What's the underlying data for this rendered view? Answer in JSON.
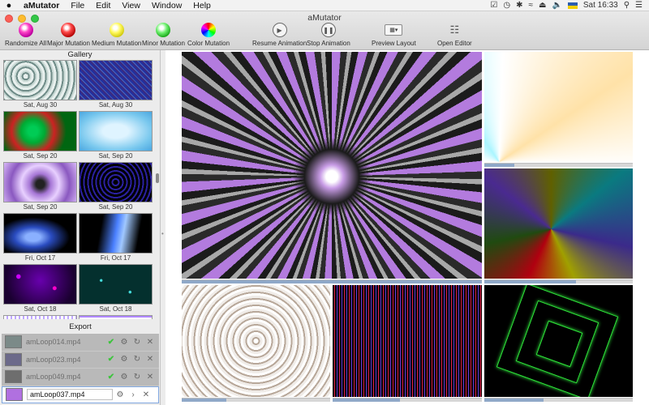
{
  "menubar": {
    "app_name": "aMutator",
    "menus": [
      "File",
      "Edit",
      "View",
      "Window",
      "Help"
    ],
    "clock": "Sat 16:33"
  },
  "window": {
    "title": "aMutator"
  },
  "toolbar": {
    "randomize_all": "Randomize All",
    "major_mutation": "Major Mutation",
    "medium_mutation": "Medium Mutation",
    "minor_mutation": "Minor Mutation",
    "color_mutation": "Color Mutation",
    "resume_animation": "Resume Animation",
    "stop_animation": "Stop Animation",
    "preview_layout": "Preview Layout",
    "open_editor": "Open Editor"
  },
  "gallery": {
    "header": "Gallery",
    "items": [
      {
        "label": "Sat, Aug 30"
      },
      {
        "label": "Sat, Aug 30"
      },
      {
        "label": "Sat, Sep 20"
      },
      {
        "label": "Sat, Sep 20"
      },
      {
        "label": "Sat, Sep 20"
      },
      {
        "label": "Sat, Sep 20"
      },
      {
        "label": "Fri, Oct 17"
      },
      {
        "label": "Fri, Oct 17"
      },
      {
        "label": "Sat, Oct 18"
      },
      {
        "label": "Sat, Oct 18"
      },
      {
        "label": ""
      },
      {
        "label": ""
      }
    ]
  },
  "export": {
    "header": "Export",
    "items": [
      {
        "name": "amLoop014.mp4",
        "status": "done"
      },
      {
        "name": "amLoop023.mp4",
        "status": "done"
      },
      {
        "name": "amLoop049.mp4",
        "status": "done"
      },
      {
        "name": "amLoop037.mp4",
        "status": "editing"
      }
    ]
  },
  "preview": {
    "main_progress": 1.0,
    "tr_progress": 0.2,
    "mr_progress": 0.62,
    "bl_progress": 0.3,
    "bm_progress": 0.45,
    "br_progress": 0.4
  }
}
